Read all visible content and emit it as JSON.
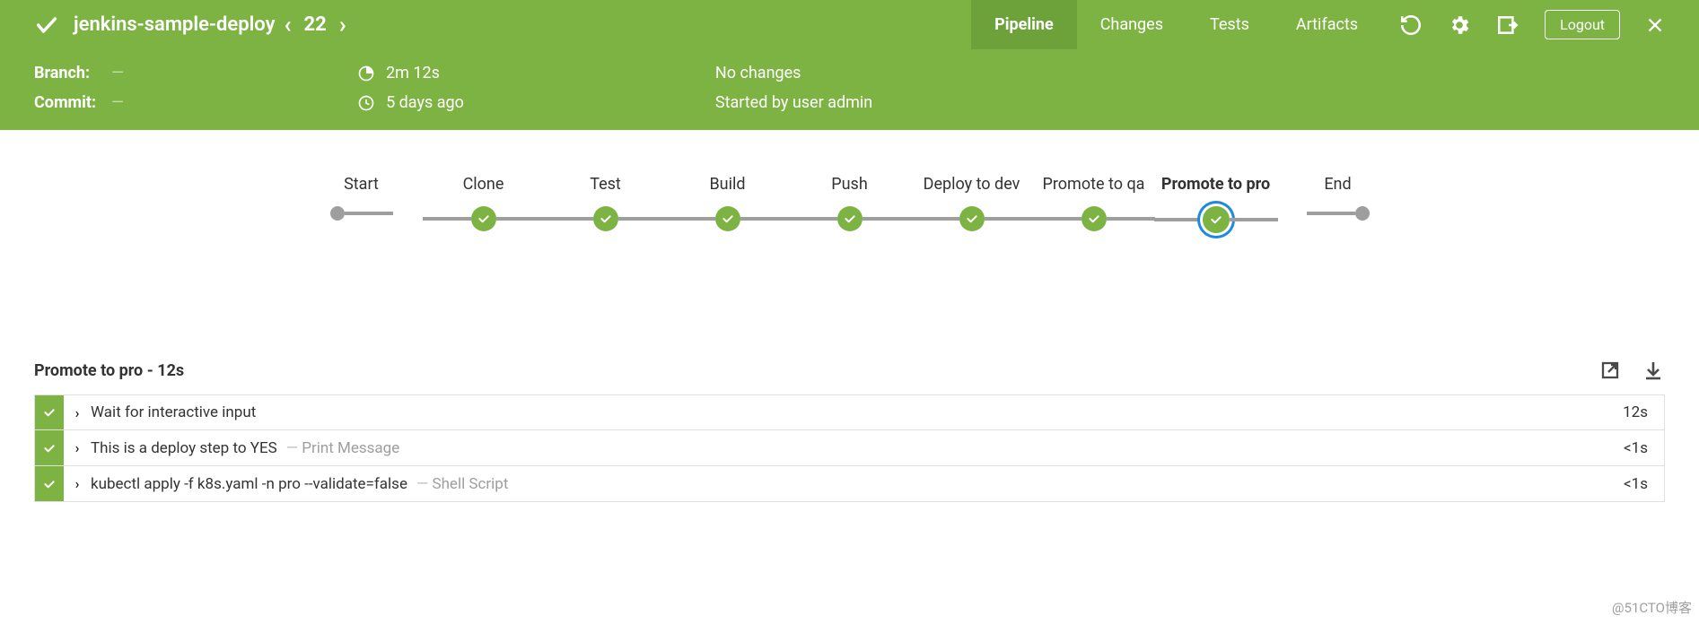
{
  "header": {
    "job_name": "jenkins-sample-deploy",
    "run_number": "22",
    "tabs": [
      "Pipeline",
      "Changes",
      "Tests",
      "Artifacts"
    ],
    "active_tab": "Pipeline",
    "logout": "Logout"
  },
  "meta": {
    "branch_label": "Branch:",
    "branch_value": "—",
    "commit_label": "Commit:",
    "commit_value": "—",
    "duration": "2m 12s",
    "age": "5 days ago",
    "changes": "No changes",
    "started_by": "Started by user admin"
  },
  "pipeline": {
    "stages": [
      "Start",
      "Clone",
      "Test",
      "Build",
      "Push",
      "Deploy to dev",
      "Promote to qa",
      "Promote to pro",
      "End"
    ],
    "selected": "Promote to pro"
  },
  "steps": {
    "title_stage": "Promote to pro",
    "title_sep": " - ",
    "title_time": "12s",
    "rows": [
      {
        "label": "Wait for interactive input",
        "sub": "",
        "time": "12s"
      },
      {
        "label": "This is a deploy step to YES",
        "sub": "Print Message",
        "time": "<1s"
      },
      {
        "label": "kubectl apply -f k8s.yaml -n pro --validate=false",
        "sub": "Shell Script",
        "time": "<1s"
      }
    ]
  },
  "watermark": "@51CTO博客"
}
